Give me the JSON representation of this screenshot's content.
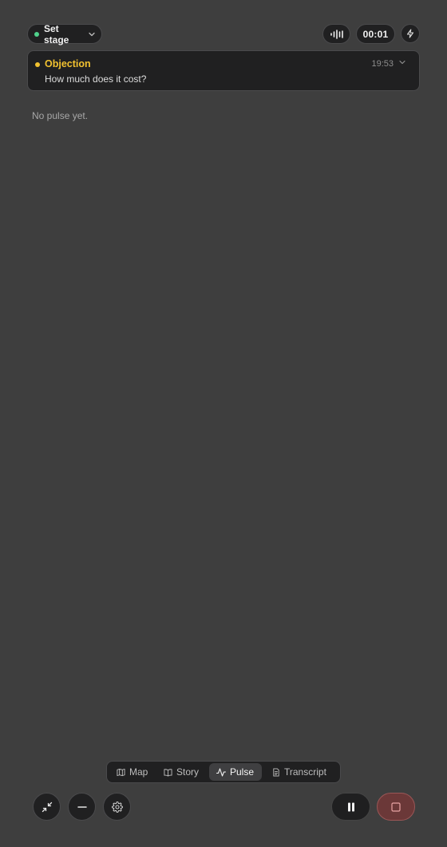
{
  "header": {
    "stage_label": "Set stage",
    "timer": "00:01"
  },
  "card": {
    "title": "Objection",
    "text": "How much does it cost?",
    "time": "19:53"
  },
  "pulse": {
    "empty_text": "No pulse yet."
  },
  "tabs": [
    {
      "label": "Map",
      "icon": "map-icon"
    },
    {
      "label": "Story",
      "icon": "book-icon"
    },
    {
      "label": "Pulse",
      "icon": "pulse-icon",
      "active": true
    },
    {
      "label": "Transcript",
      "icon": "document-icon"
    }
  ],
  "colors": {
    "background": "#3e3e3e",
    "surface": "#202021",
    "stage_dot": "#4fd18b",
    "objection_accent": "#f2c230",
    "stop_button": "#6b3838"
  }
}
